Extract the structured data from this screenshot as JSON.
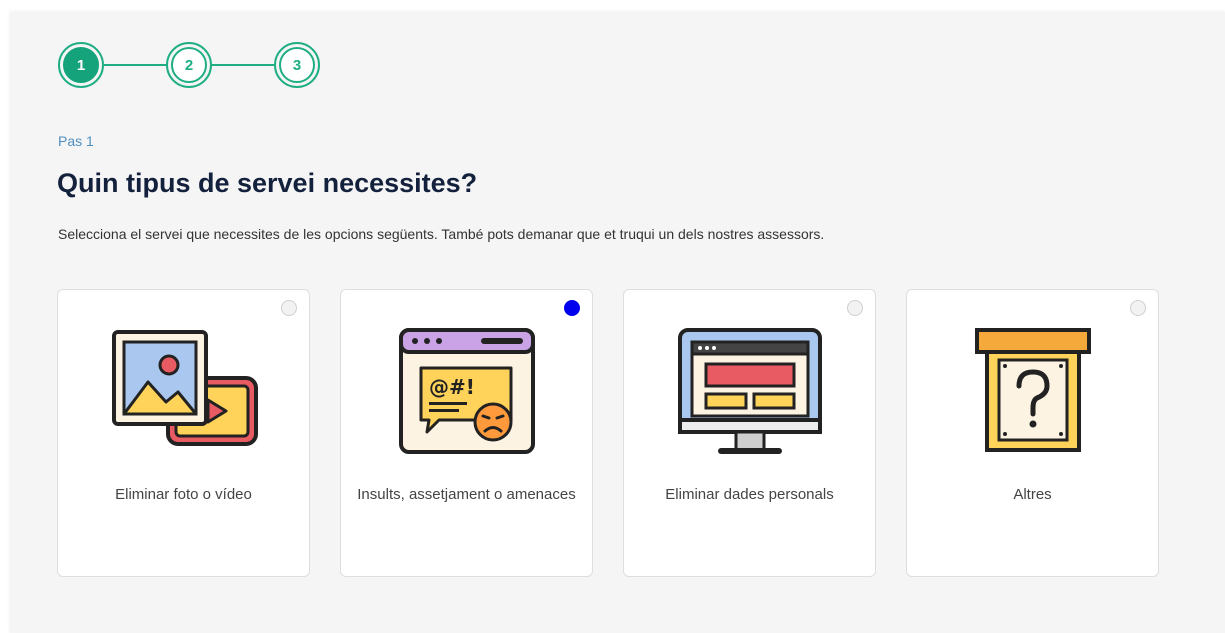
{
  "stepper": {
    "steps": [
      {
        "number": "1",
        "active": true
      },
      {
        "number": "2",
        "active": false
      },
      {
        "number": "3",
        "active": false
      }
    ]
  },
  "header": {
    "eyebrow": "Pas 1",
    "title": "Quin tipus de servei necessites?",
    "subtitle": "Selecciona el servei que necessites de les opcions següents. També pots demanar que et truqui un dels nostres assessors."
  },
  "options": [
    {
      "label": "Eliminar foto o vídeo",
      "icon": "photo-video-icon",
      "selected": false
    },
    {
      "label": "Insults, assetjament o amenaces",
      "icon": "angry-message-icon",
      "selected": true
    },
    {
      "label": "Eliminar dades personals",
      "icon": "monitor-webpage-icon",
      "selected": false
    },
    {
      "label": "Altres",
      "icon": "question-box-icon",
      "selected": false
    }
  ],
  "colors": {
    "accent": "#14a37a",
    "selected_radio": "#0000ee",
    "title": "#14213d",
    "eyebrow": "#4f8fc0"
  }
}
